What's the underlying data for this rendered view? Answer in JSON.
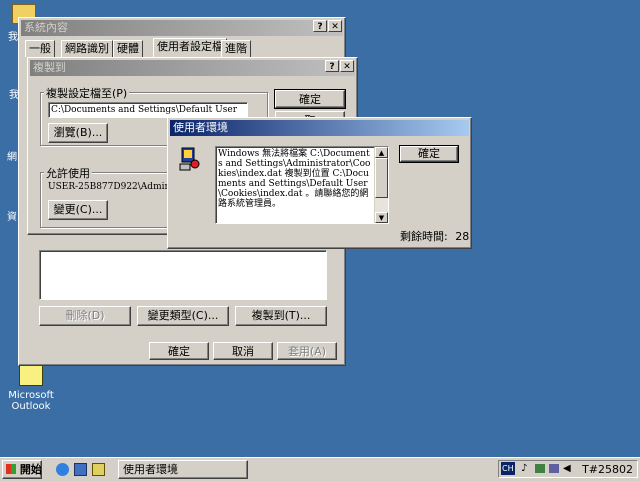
{
  "desktop": {
    "icons": [
      {
        "label": "我"
      },
      {
        "label": "我"
      },
      {
        "label": "網"
      },
      {
        "label": "資"
      },
      {
        "label": "Microsoft Outlook"
      }
    ]
  },
  "system_props": {
    "title": "系統內容",
    "tabs": [
      "一般",
      "網路識別",
      "硬體",
      "使用者設定檔",
      "進階"
    ],
    "delete_btn": "刪除(D)",
    "change_type_btn": "變更類型(C)...",
    "copy_to_btn": "複製到(T)...",
    "ok": "確定",
    "cancel": "取消",
    "apply": "套用(A)"
  },
  "copy_to": {
    "title": "複製到",
    "group_copy_label": "複製設定檔至(P)",
    "path_value": "C:\\Documents and Settings\\Default User",
    "browse_btn": "瀏覽(B)...",
    "group_permit_label": "允許使用",
    "user_value": "USER-25B877D922\\Administrator",
    "change_btn": "變更(C)...",
    "ok": "確定",
    "cancel_partial": "取"
  },
  "user_env": {
    "title": "使用者環境",
    "message": "Windows 無法將檔案 C:\\Documents and Settings\\Administrator\\Cookies\\index.dat 複製到位置 C:\\Documents and Settings\\Default User\\Cookies\\index.dat 。請聯絡您的網路系統管理員。",
    "ok": "確定",
    "countdown_label": "剩餘時間:",
    "countdown_value": "28"
  },
  "taskbar": {
    "start": "開始",
    "task": "使用者環境",
    "tray_text": "T#25802",
    "tray_ime": "CH"
  },
  "colors": {
    "desktop": "#3a6ea5",
    "active_title": "#0a246a",
    "inactive_title": "#808080",
    "face": "#d4d0c8"
  }
}
